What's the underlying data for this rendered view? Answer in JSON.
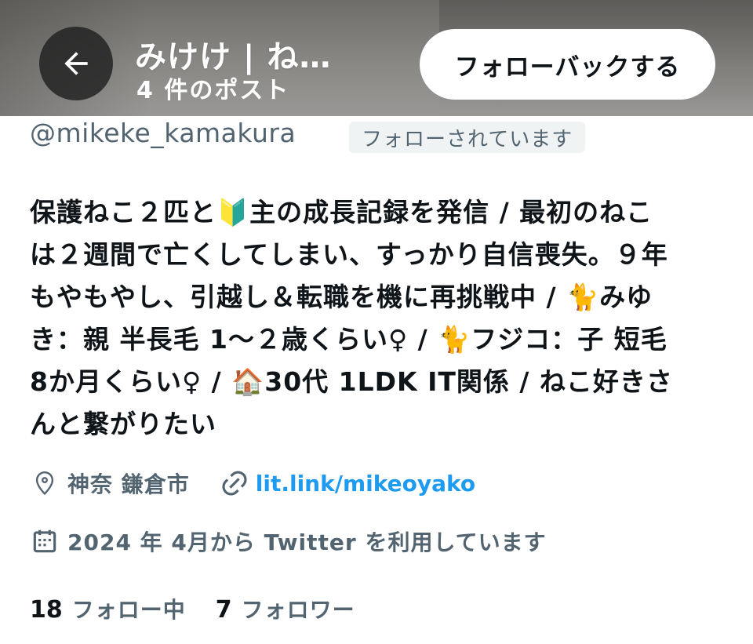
{
  "header": {
    "title": "みけけ | ね…",
    "subtitle": "4 件のポスト",
    "followback_label": "フォローバックする"
  },
  "profile": {
    "handle": "@mikeke_kamakura",
    "follows_you": "フォローされています",
    "bio_lines": [
      "保護ねこ２匹と🔰主の成長記録を発信 / 最初のねこ",
      "は２週間で亡くしてしまい、すっかり自信喪失。９年",
      "もやもやし、引越し＆転職を機に再挑戦中 / 🐈みゆ",
      "き：親 半長毛 1〜２歳くらい♀ / 🐈フジコ：子 短毛",
      "8か月くらい♀ / 🏠30代 1LDK IT関係 / ねこ好きさ",
      "んと繋がりたい"
    ],
    "location": "神奈 鎌倉市",
    "link": "lit.link/mikeoyako",
    "joined": "2024 年 4月から Twitter を利用しています"
  },
  "stats": {
    "following_count": "18",
    "following_label": "フォロー中",
    "followers_count": "7",
    "followers_label": "フォロワー"
  },
  "icons": {
    "back": "arrow-left-icon",
    "location": "location-pin-icon",
    "link": "link-icon",
    "calendar": "calendar-icon"
  },
  "colors": {
    "link": "#1d9bf0",
    "secondary_text": "#536471",
    "primary_text": "#0f1419"
  }
}
